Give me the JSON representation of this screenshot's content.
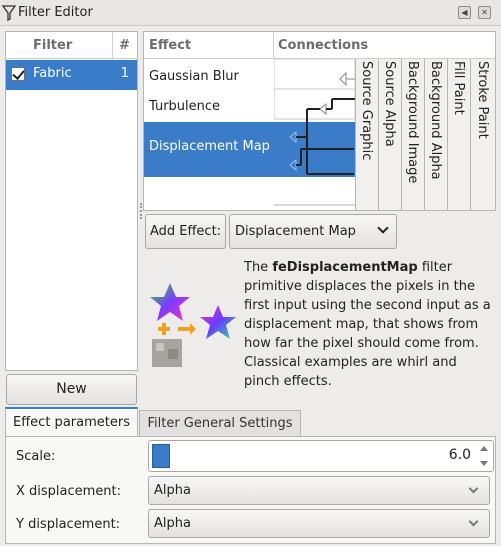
{
  "window": {
    "title": "Filter Editor"
  },
  "filter_list": {
    "col_filter": "Filter",
    "col_count": "#",
    "items": [
      {
        "name": "Fabric",
        "count": "1",
        "checked": true
      }
    ],
    "new_label": "New"
  },
  "effects": {
    "col_effect": "Effect",
    "col_connections": "Connections",
    "items": [
      "Gaussian Blur",
      "Turbulence",
      "Displacement Map"
    ],
    "selected": "Displacement Map",
    "sources": [
      "Source Graphic",
      "Source Alpha",
      "Background Image",
      "Background Alpha",
      "Fill Paint",
      "Stroke Paint"
    ]
  },
  "add_effect": {
    "button_label": "Add Effect:",
    "selected_effect": "Displacement Map"
  },
  "description": {
    "primitive": "feDisplacementMap",
    "lead": "The ",
    "rest": " filter primitive displaces the pixels in the first input using the second input as a displacement map, that shows from how far the pixel should come from. Classical examples are whirl and pinch effects."
  },
  "tabs": {
    "effect_parameters": "Effect parameters",
    "general_settings": "Filter General Settings"
  },
  "params": {
    "scale_label": "Scale:",
    "scale_value": "6.0",
    "x_label": "X displacement:",
    "x_value": "Alpha",
    "y_label": "Y displacement:",
    "y_value": "Alpha"
  },
  "colors": {
    "selection": "#3b7cc8",
    "window_bg": "#edeceb"
  }
}
